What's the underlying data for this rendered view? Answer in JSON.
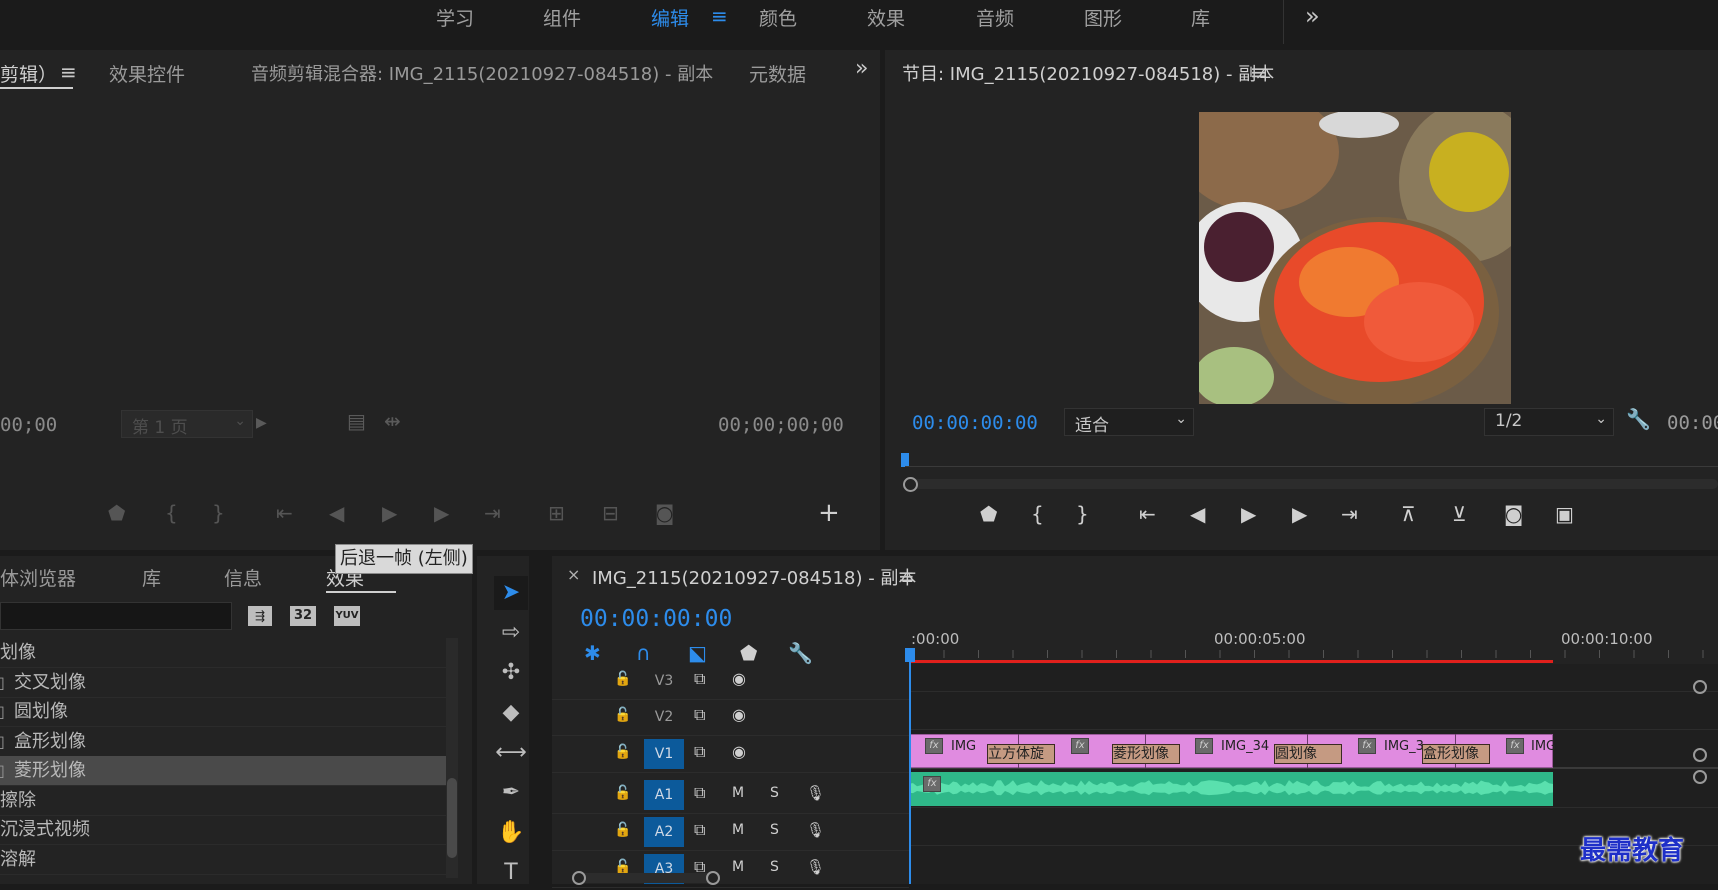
{
  "workspaces": {
    "items": [
      "学习",
      "组件",
      "编辑",
      "颜色",
      "效果",
      "音频",
      "图形",
      "库"
    ],
    "active_index": 2,
    "overflow_glyph": "»"
  },
  "source_panel": {
    "tabs": [
      "剪辑）",
      "效果控件",
      "音频剪辑混合器: IMG_2115(20210927-084518)  - 副本",
      "元数据"
    ],
    "active_index": 0,
    "left_timecode": "00;00",
    "page_select": "第 1 页",
    "right_timecode": "00;00;00;00"
  },
  "program_panel": {
    "title": "节目: IMG_2115(20210927-084518)  - 副本",
    "timecode": "00:00:00:00",
    "fit_select": "适合",
    "resolution_select": "1/2",
    "right_timecode": "00:00"
  },
  "tooltip": {
    "text": "后退一帧 (左侧)"
  },
  "effects_panel": {
    "tabs": [
      "体浏览器",
      "库",
      "信息",
      "效果"
    ],
    "active_index": 3,
    "toolbar_badges": [
      "32",
      "YUV"
    ],
    "items": [
      {
        "label": "划像",
        "level": 0
      },
      {
        "label": "交叉划像",
        "level": 1
      },
      {
        "label": "圆划像",
        "level": 1
      },
      {
        "label": "盒形划像",
        "level": 1
      },
      {
        "label": "菱形划像",
        "level": 1,
        "selected": true
      },
      {
        "label": "擦除",
        "level": 0
      },
      {
        "label": "沉浸式视频",
        "level": 0
      },
      {
        "label": "溶解",
        "level": 0
      }
    ]
  },
  "timeline": {
    "close_glyph": "×",
    "title": "IMG_2115(20210927-084518)  - 副本",
    "timecode": "00:00:00:00",
    "ruler_labels": [
      ":00:00",
      "00:00:05:00",
      "00:00:10:00"
    ],
    "tracks": [
      {
        "name": "V3",
        "target": false,
        "type": "video"
      },
      {
        "name": "V2",
        "target": false,
        "type": "video"
      },
      {
        "name": "V1",
        "target": true,
        "type": "video"
      },
      {
        "name": "A1",
        "target": true,
        "type": "audio"
      },
      {
        "name": "A2",
        "target": true,
        "type": "audio"
      },
      {
        "name": "A3",
        "target": true,
        "type": "audio"
      }
    ],
    "audio_buttons": {
      "mute": "M",
      "solo": "S"
    },
    "clip_labels": [
      "IMG",
      "IMG_34",
      "IMG_3",
      "IMG"
    ],
    "transitions": [
      "立方体旋",
      "菱形划像",
      "圆划像",
      "盒形划像"
    ],
    "fx_glyph": "fx"
  },
  "watermark": {
    "text": "最需教育"
  },
  "colors": {
    "accent": "#2d8ceb",
    "clip_video": "#e08be0",
    "clip_audio": "#2fb889",
    "playhead_bar": "#e0201c",
    "watermark": "#1e2fc8"
  }
}
